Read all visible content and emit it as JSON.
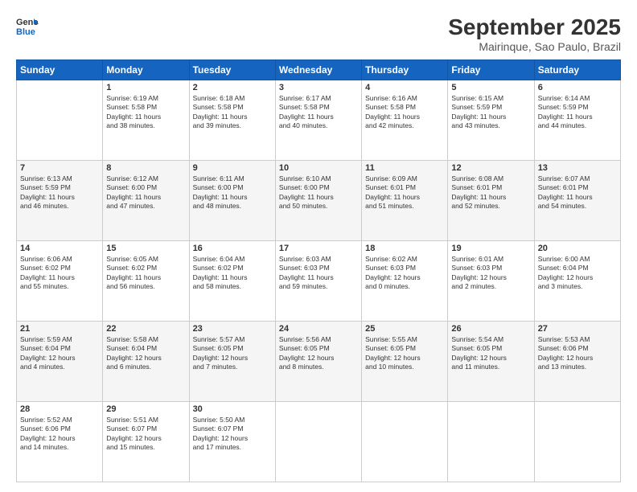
{
  "header": {
    "logo_line1": "General",
    "logo_line2": "Blue",
    "main_title": "September 2025",
    "subtitle": "Mairinque, Sao Paulo, Brazil"
  },
  "days_of_week": [
    "Sunday",
    "Monday",
    "Tuesday",
    "Wednesday",
    "Thursday",
    "Friday",
    "Saturday"
  ],
  "weeks": [
    [
      {
        "day": "",
        "info": ""
      },
      {
        "day": "1",
        "info": "Sunrise: 6:19 AM\nSunset: 5:58 PM\nDaylight: 11 hours\nand 38 minutes."
      },
      {
        "day": "2",
        "info": "Sunrise: 6:18 AM\nSunset: 5:58 PM\nDaylight: 11 hours\nand 39 minutes."
      },
      {
        "day": "3",
        "info": "Sunrise: 6:17 AM\nSunset: 5:58 PM\nDaylight: 11 hours\nand 40 minutes."
      },
      {
        "day": "4",
        "info": "Sunrise: 6:16 AM\nSunset: 5:58 PM\nDaylight: 11 hours\nand 42 minutes."
      },
      {
        "day": "5",
        "info": "Sunrise: 6:15 AM\nSunset: 5:59 PM\nDaylight: 11 hours\nand 43 minutes."
      },
      {
        "day": "6",
        "info": "Sunrise: 6:14 AM\nSunset: 5:59 PM\nDaylight: 11 hours\nand 44 minutes."
      }
    ],
    [
      {
        "day": "7",
        "info": "Sunrise: 6:13 AM\nSunset: 5:59 PM\nDaylight: 11 hours\nand 46 minutes."
      },
      {
        "day": "8",
        "info": "Sunrise: 6:12 AM\nSunset: 6:00 PM\nDaylight: 11 hours\nand 47 minutes."
      },
      {
        "day": "9",
        "info": "Sunrise: 6:11 AM\nSunset: 6:00 PM\nDaylight: 11 hours\nand 48 minutes."
      },
      {
        "day": "10",
        "info": "Sunrise: 6:10 AM\nSunset: 6:00 PM\nDaylight: 11 hours\nand 50 minutes."
      },
      {
        "day": "11",
        "info": "Sunrise: 6:09 AM\nSunset: 6:01 PM\nDaylight: 11 hours\nand 51 minutes."
      },
      {
        "day": "12",
        "info": "Sunrise: 6:08 AM\nSunset: 6:01 PM\nDaylight: 11 hours\nand 52 minutes."
      },
      {
        "day": "13",
        "info": "Sunrise: 6:07 AM\nSunset: 6:01 PM\nDaylight: 11 hours\nand 54 minutes."
      }
    ],
    [
      {
        "day": "14",
        "info": "Sunrise: 6:06 AM\nSunset: 6:02 PM\nDaylight: 11 hours\nand 55 minutes."
      },
      {
        "day": "15",
        "info": "Sunrise: 6:05 AM\nSunset: 6:02 PM\nDaylight: 11 hours\nand 56 minutes."
      },
      {
        "day": "16",
        "info": "Sunrise: 6:04 AM\nSunset: 6:02 PM\nDaylight: 11 hours\nand 58 minutes."
      },
      {
        "day": "17",
        "info": "Sunrise: 6:03 AM\nSunset: 6:03 PM\nDaylight: 11 hours\nand 59 minutes."
      },
      {
        "day": "18",
        "info": "Sunrise: 6:02 AM\nSunset: 6:03 PM\nDaylight: 12 hours\nand 0 minutes."
      },
      {
        "day": "19",
        "info": "Sunrise: 6:01 AM\nSunset: 6:03 PM\nDaylight: 12 hours\nand 2 minutes."
      },
      {
        "day": "20",
        "info": "Sunrise: 6:00 AM\nSunset: 6:04 PM\nDaylight: 12 hours\nand 3 minutes."
      }
    ],
    [
      {
        "day": "21",
        "info": "Sunrise: 5:59 AM\nSunset: 6:04 PM\nDaylight: 12 hours\nand 4 minutes."
      },
      {
        "day": "22",
        "info": "Sunrise: 5:58 AM\nSunset: 6:04 PM\nDaylight: 12 hours\nand 6 minutes."
      },
      {
        "day": "23",
        "info": "Sunrise: 5:57 AM\nSunset: 6:05 PM\nDaylight: 12 hours\nand 7 minutes."
      },
      {
        "day": "24",
        "info": "Sunrise: 5:56 AM\nSunset: 6:05 PM\nDaylight: 12 hours\nand 8 minutes."
      },
      {
        "day": "25",
        "info": "Sunrise: 5:55 AM\nSunset: 6:05 PM\nDaylight: 12 hours\nand 10 minutes."
      },
      {
        "day": "26",
        "info": "Sunrise: 5:54 AM\nSunset: 6:05 PM\nDaylight: 12 hours\nand 11 minutes."
      },
      {
        "day": "27",
        "info": "Sunrise: 5:53 AM\nSunset: 6:06 PM\nDaylight: 12 hours\nand 13 minutes."
      }
    ],
    [
      {
        "day": "28",
        "info": "Sunrise: 5:52 AM\nSunset: 6:06 PM\nDaylight: 12 hours\nand 14 minutes."
      },
      {
        "day": "29",
        "info": "Sunrise: 5:51 AM\nSunset: 6:07 PM\nDaylight: 12 hours\nand 15 minutes."
      },
      {
        "day": "30",
        "info": "Sunrise: 5:50 AM\nSunset: 6:07 PM\nDaylight: 12 hours\nand 17 minutes."
      },
      {
        "day": "",
        "info": ""
      },
      {
        "day": "",
        "info": ""
      },
      {
        "day": "",
        "info": ""
      },
      {
        "day": "",
        "info": ""
      }
    ]
  ]
}
